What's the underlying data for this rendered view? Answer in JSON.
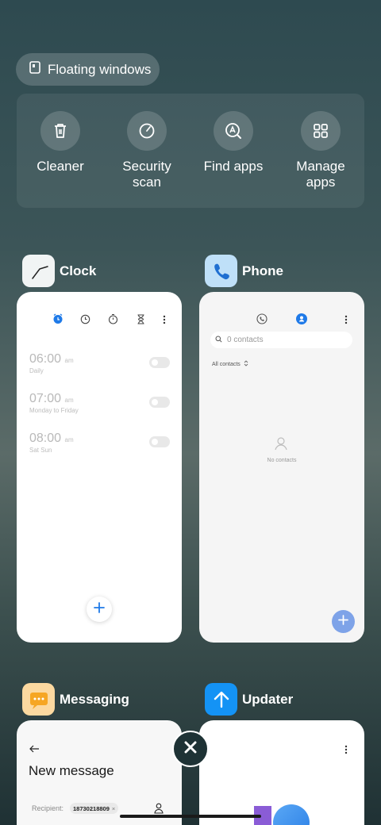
{
  "floating_windows": {
    "label": "Floating windows"
  },
  "quick_actions": [
    {
      "label": "Cleaner",
      "icon": "trash-icon"
    },
    {
      "label": "Security\nscan",
      "icon": "security-scan-icon"
    },
    {
      "label": "Find apps",
      "icon": "find-apps-icon"
    },
    {
      "label": "Manage\napps",
      "icon": "grid-icon"
    }
  ],
  "clock": {
    "name": "Clock",
    "alarms": [
      {
        "time": "06:00",
        "ampm": "am",
        "repeat": "Daily"
      },
      {
        "time": "07:00",
        "ampm": "am",
        "repeat": "Monday to Friday"
      },
      {
        "time": "08:00",
        "ampm": "am",
        "repeat": "Sat Sun"
      }
    ]
  },
  "phone": {
    "name": "Phone",
    "search_placeholder": "0 contacts",
    "filter": "All contacts",
    "empty_text": "No contacts"
  },
  "messaging": {
    "name": "Messaging",
    "title": "New message",
    "recipient_label": "Recipient:",
    "recipient_chip": "18730218809"
  },
  "updater": {
    "name": "Updater"
  },
  "colors": {
    "accent_blue": "#1f7ae8",
    "phone_fab": "#7ea3e8",
    "updater_icon": "#1493f5",
    "messaging_icon": "#f6a623"
  }
}
